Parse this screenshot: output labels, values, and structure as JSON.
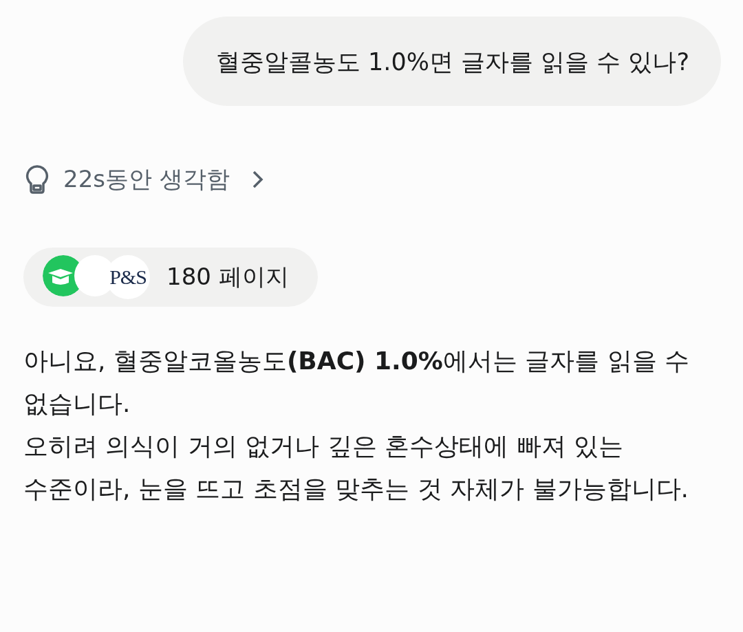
{
  "user_message": {
    "text": "혈중알콜농도 1.0%면 글자를 읽을 수 있나?"
  },
  "thinking": {
    "label": "22s동안 생각함"
  },
  "sources": {
    "icons": [
      {
        "kind": "cap"
      },
      {
        "kind": "blank"
      },
      {
        "kind": "wordmark",
        "text": "P&S"
      }
    ],
    "count_label": "180 페이지"
  },
  "answer": {
    "paragraphs": [
      "아니요, 혈중알코올농도**(BAC) 1.0%**에서는 글자를 읽을 수 없습니다.",
      "오히려 의식이 거의 없거나 깊은 혼수상태에 빠져 있는 수준이라, 눈을 뜨고 초점을 맞추는 것 자체가 불가능합니다."
    ]
  }
}
